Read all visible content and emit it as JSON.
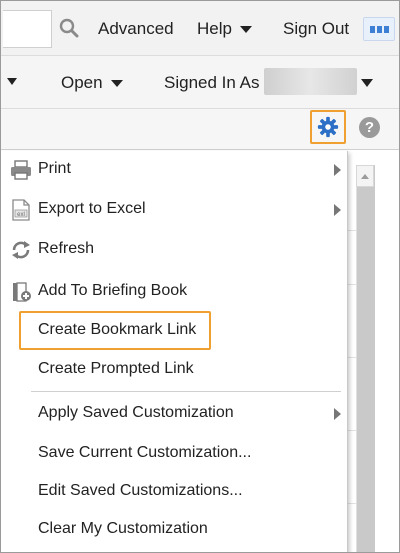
{
  "header": {
    "advanced_label": "Advanced",
    "help_label": "Help",
    "signout_label": "Sign Out"
  },
  "subheader": {
    "open_label": "Open",
    "signed_in_label": "Signed In As"
  },
  "menu": {
    "items": [
      {
        "label": "Print",
        "icon": "printer-icon",
        "submenu": true
      },
      {
        "label": "Export to Excel",
        "icon": "excel-file-icon",
        "submenu": true
      },
      {
        "label": "Refresh",
        "icon": "refresh-icon",
        "submenu": false
      },
      {
        "label": "Add To Briefing Book",
        "icon": "briefing-book-icon",
        "submenu": false
      },
      {
        "label": "Create Bookmark Link",
        "icon": null,
        "submenu": false,
        "highlighted": true
      },
      {
        "label": "Create Prompted Link",
        "icon": null,
        "submenu": false
      },
      {
        "label": "Apply Saved Customization",
        "icon": null,
        "submenu": true
      },
      {
        "label": "Save Current Customization...",
        "icon": null,
        "submenu": false
      },
      {
        "label": "Edit Saved Customizations...",
        "icon": null,
        "submenu": false
      },
      {
        "label": "Clear My Customization",
        "icon": null,
        "submenu": false
      }
    ]
  },
  "toolbar": {
    "help_symbol": "?"
  },
  "colors": {
    "highlight": "#f0a030",
    "gear": "#2c6fc6",
    "apps": "#3e7fd6"
  }
}
